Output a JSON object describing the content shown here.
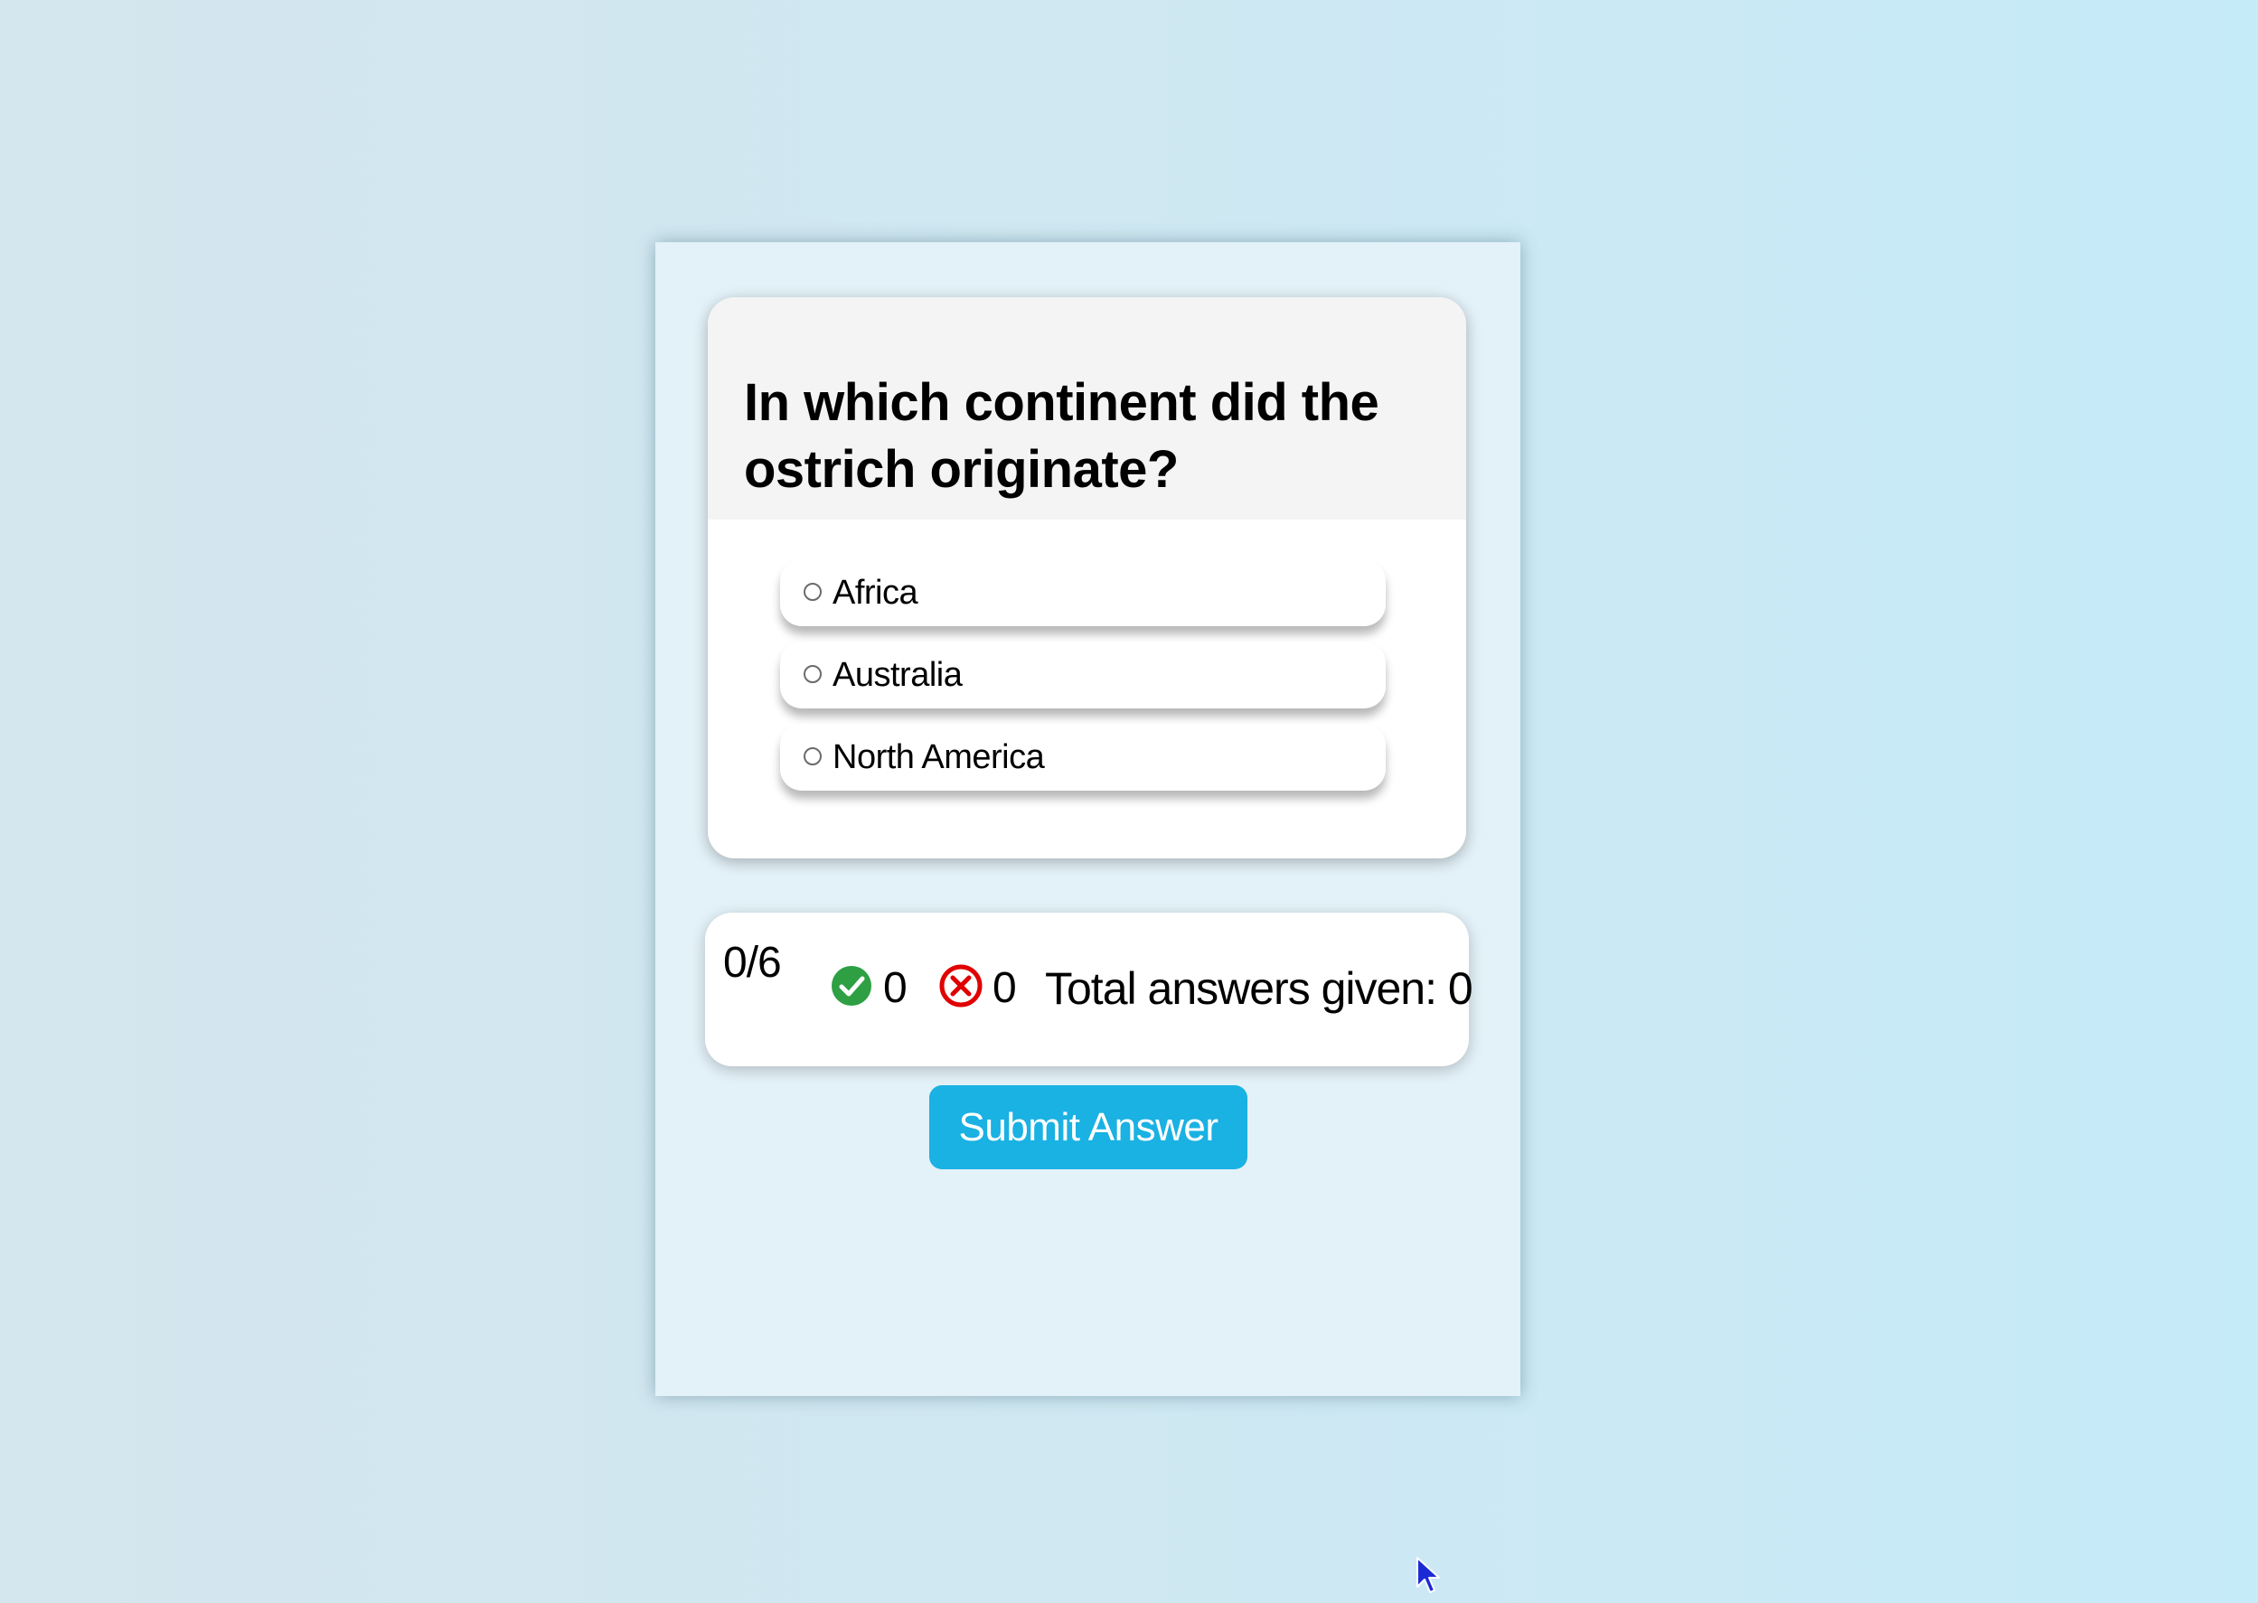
{
  "question": {
    "text": "In which continent did the ostrich originate?"
  },
  "options": [
    {
      "label": "Africa",
      "selected": false
    },
    {
      "label": "Australia",
      "selected": false
    },
    {
      "label": "North America",
      "selected": false
    }
  ],
  "score": {
    "progress": "0/6",
    "correct_count": "0",
    "wrong_count": "0",
    "total_label": "Total answers given: 0"
  },
  "submit": {
    "label": "Submit Answer"
  },
  "icons": {
    "correct": "check-circle-icon",
    "wrong": "x-circle-icon",
    "cursor": "mouse-pointer-icon"
  },
  "colors": {
    "accent": "#1ab1e3",
    "correct": "#2ea043",
    "wrong": "#e00000"
  }
}
